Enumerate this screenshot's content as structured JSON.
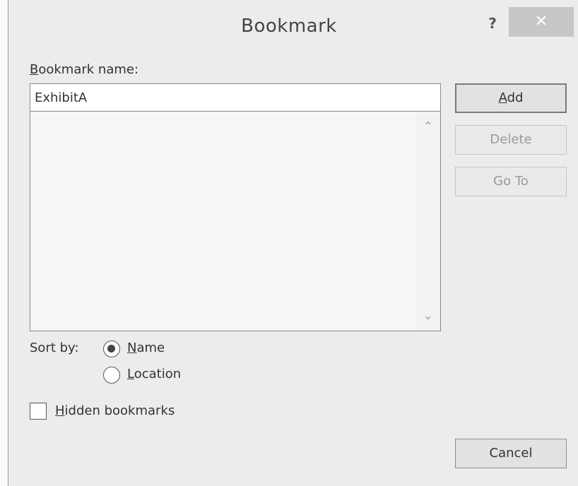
{
  "window": {
    "title": "Bookmark",
    "help_label": "?",
    "close_label": "✕"
  },
  "form": {
    "name_label_underlined": "B",
    "name_label_rest": "ookmark name:",
    "name_value": "ExhibitA",
    "sort_by_label": "Sort by:",
    "sort_options": [
      {
        "underlined": "N",
        "rest": "ame",
        "selected": true
      },
      {
        "underlined": "L",
        "rest": "ocation",
        "selected": false
      }
    ],
    "hidden_underlined": "H",
    "hidden_rest": "idden bookmarks",
    "hidden_checked": false
  },
  "buttons": {
    "add_underlined": "A",
    "add_rest": "dd",
    "delete": "Delete",
    "goto": "Go To",
    "cancel": "Cancel"
  },
  "list": {
    "items": [],
    "scroll_up": "⌃",
    "scroll_down": "⌄"
  }
}
